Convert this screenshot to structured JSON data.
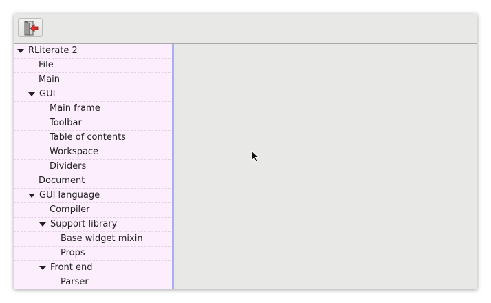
{
  "toolbar": {
    "quit_button": {
      "icon": "quit-icon"
    }
  },
  "toc": {
    "items": [
      {
        "label": "RLiterate 2",
        "expandable": true
      },
      {
        "label": "File",
        "expandable": false
      },
      {
        "label": "Main",
        "expandable": false
      },
      {
        "label": "GUI",
        "expandable": true
      },
      {
        "label": "Main frame",
        "expandable": false
      },
      {
        "label": "Toolbar",
        "expandable": false
      },
      {
        "label": "Table of contents",
        "expandable": false
      },
      {
        "label": "Workspace",
        "expandable": false
      },
      {
        "label": "Dividers",
        "expandable": false
      },
      {
        "label": "Document",
        "expandable": false
      },
      {
        "label": "GUI language",
        "expandable": true
      },
      {
        "label": "Compiler",
        "expandable": false
      },
      {
        "label": "Support library",
        "expandable": true
      },
      {
        "label": "Base widget mixin",
        "expandable": false
      },
      {
        "label": "Props",
        "expandable": false
      },
      {
        "label": "Front end",
        "expandable": true
      },
      {
        "label": "Parser",
        "expandable": false
      }
    ]
  },
  "colors": {
    "toc_background": "#fdeefe",
    "divider": "#a9aef0",
    "workspace_background": "#e8e8e7"
  }
}
